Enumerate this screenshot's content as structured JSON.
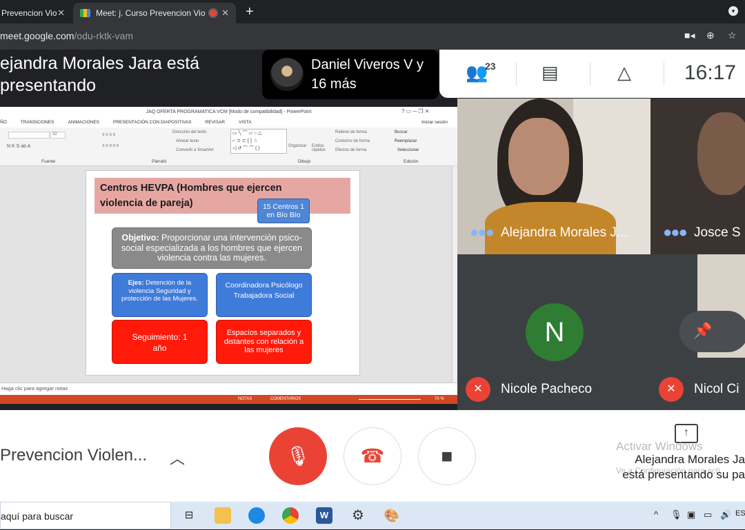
{
  "browser": {
    "tabs": [
      {
        "label": "Prevencion Vio",
        "close": "✕"
      },
      {
        "label": "Meet: j. Curso Prevencion Vio",
        "close": "✕"
      }
    ],
    "new_tab": "+",
    "url_domain": "meet.google.com",
    "url_path": "/odu-rktk-vam"
  },
  "meet": {
    "presenting_banner": "ejandra Morales Jara está presentando",
    "people_chip": "Daniel Viveros V y 16 más",
    "participant_count": "23",
    "clock": "16:17"
  },
  "ppt": {
    "window_title": "JAQ OFERTA PROGRAMATICA VCM [Modo de compatibilidad] - PowerPoint",
    "window_controls": "? ▭ ─ ❐ ✕",
    "menu": [
      "ÑO",
      "TRANSICIONES",
      "ANIMACIONES",
      "PRESENTACIÓN CON DIAPOSITIVAS",
      "REVISAR",
      "VISTA"
    ],
    "signin": "Iniciar sesión",
    "ribbon_groups": [
      "Fuente",
      "Párrafo",
      "Dibujo",
      "Edición"
    ],
    "ribbon_text": {
      "font_size": "32",
      "text_direction": "Dirección del texto",
      "align_text": "Alinear texto",
      "smartart": "Convertir a SmartArt",
      "arrange": "Organizar",
      "quick_styles": "Estilos rápidos",
      "fill": "Relleno de forma",
      "outline": "Contorno de forma",
      "effects": "Efectos de forma",
      "find": "Buscar",
      "replace": "Reemplazar",
      "select": "Seleccionar"
    },
    "slide": {
      "title": "Centros HEVPA (Hombres que ejercen violencia de pareja)",
      "badge": "15 Centros 1 en Bío Bío",
      "objetivo_label": "Objetivo:",
      "objetivo_text": " Proporcionar una intervención psico-social especializada a los hombres que ejercen violencia contra las mujeres.",
      "ejes_label": "Ejes:",
      "ejes_text": " Detención de la violencia Seguridad y protección de las Mujeres.",
      "coord_text": "Coordinadora Psicólogo Trabajadora Social",
      "seguimiento_text": "Seguimiento: 1 año",
      "espacios_text": "Espacios separados y distantes con relación a las mujeres"
    },
    "notes_placeholder": "Haga clic para agregar notas",
    "status": {
      "notes": "NOTAS",
      "comments": "COMENTARIOS",
      "zoom": "70 %"
    }
  },
  "tiles": [
    {
      "name": "Alejandra Morales J..."
    },
    {
      "name": "Josce S"
    },
    {
      "name": "Nicole Pacheco",
      "initial": "N"
    },
    {
      "name": "Nicol Ci"
    }
  ],
  "controls": {
    "meeting_name": "Prevencion Violen...",
    "presenter_line1": "Alejandra Morales Ja",
    "presenter_line2": "está presentando su pa",
    "watermark1": "Activar Windows",
    "watermark2": "Ve a Configuración para acti"
  },
  "taskbar": {
    "search_placeholder": "aquí para buscar",
    "lang": "ES"
  }
}
